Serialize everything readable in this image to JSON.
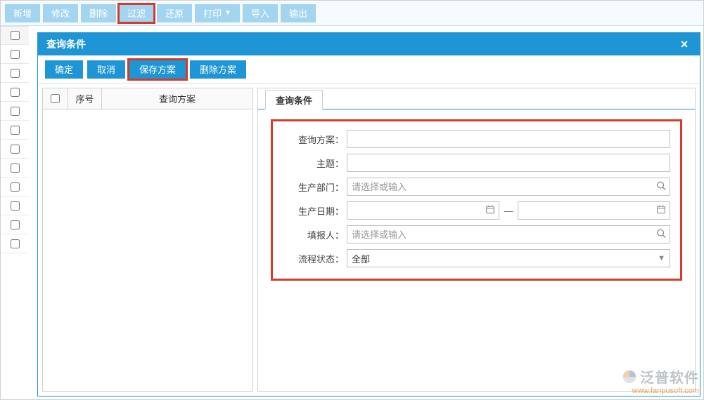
{
  "toolbar": {
    "new": "新增",
    "edit": "修改",
    "delete": "删除",
    "filter": "过滤",
    "restore": "还原",
    "print": "打印",
    "import": "导入",
    "export": "输出"
  },
  "dialog": {
    "title": "查询条件",
    "buttons": {
      "ok": "确定",
      "cancel": "取消",
      "save_scheme": "保存方案",
      "delete_scheme": "删除方案"
    },
    "scheme_table": {
      "seq_header": "序号",
      "name_header": "查询方案"
    },
    "tab_label": "查询条件",
    "form": {
      "scheme_label": "查询方案",
      "subject_label": "主题",
      "dept_label": "生产部门",
      "dept_placeholder": "请选择或输入",
      "date_label": "生产日期",
      "date_separator": "—",
      "reporter_label": "填报人",
      "reporter_placeholder": "请选择或输入",
      "status_label": "流程状态",
      "status_value": "全部",
      "colon": "："
    }
  },
  "watermark": {
    "brand": "泛普软件",
    "url": "www.fanpusoft.com"
  }
}
